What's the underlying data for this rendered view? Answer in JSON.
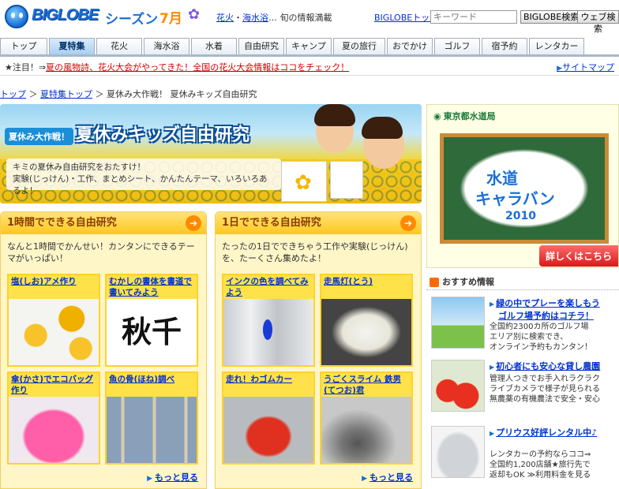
{
  "header": {
    "logo_text": "BIGLOBE",
    "season": "シーズン",
    "month": "7月",
    "tagline_link1": "花火",
    "tagline_sep": "・",
    "tagline_link2": "海水浴",
    "tagline_rest": "… 旬の情報満載",
    "top_link": "BIGLOBEトップ",
    "search_placeholder": "キーワード",
    "search_button": "BIGLOBE検索",
    "web_search_button": "ウェブ検索"
  },
  "nav": {
    "tabs": [
      {
        "label": "トップ"
      },
      {
        "label": "夏特集"
      },
      {
        "label": "花火"
      },
      {
        "label": "海水浴"
      },
      {
        "label": "水着"
      },
      {
        "label": "自由研究"
      },
      {
        "label": "キャンプ"
      },
      {
        "label": "夏の旅行"
      },
      {
        "label": "おでかけ"
      },
      {
        "label": "ゴルフ"
      },
      {
        "label": "宿予約"
      },
      {
        "label": "レンタカー"
      }
    ],
    "active_index": 1
  },
  "notice": {
    "prefix": "★注目！⇒",
    "link": "夏の風物詩、花火大会がやってきた！全国の花火大会情報はココをチェック！",
    "sitemap": "サイトマップ"
  },
  "breadcrumb": {
    "home": "トップ",
    "sep1": "＞",
    "summer": "夏特集トップ",
    "sep2": "＞",
    "current": "夏休み大作戦！ 夏休みキッズ自由研究"
  },
  "hero": {
    "badge": "夏休み大作戦！",
    "title": "夏休みキッズ自由研究",
    "line1": "キミの夏休み自由研究をおたすけ！",
    "line2": "実験(じっけん)・工作、まとめシート、かんたんテーマ、いろいろあるよ！"
  },
  "panels": [
    {
      "title": "1時間でできる自由研究",
      "desc": "なんと1時間でかんせい！カンタンにできるテーマがいっぱい！",
      "items": [
        {
          "label": "塩(しお)アメ作り"
        },
        {
          "label": "むかしの書体を書道で書いてみよう"
        },
        {
          "label": "傘(かさ)でエコバッグ作り"
        },
        {
          "label": "魚の骨(ほね)調べ"
        }
      ],
      "more": "もっと見る"
    },
    {
      "title": "1日でできる自由研究",
      "desc": "たったの1日でできちゃう工作や実験(じっけん)を、たーくさん集めたよ！",
      "items": [
        {
          "label": "インクの色を調べてみよう"
        },
        {
          "label": "走馬灯(とう)"
        },
        {
          "label": "走れ！わゴムカー"
        },
        {
          "label": "うごくスライム 鉄男(てつお)君"
        }
      ],
      "more": "もっと見る"
    }
  ],
  "shodo_text": "秋千",
  "ad": {
    "org": "東京都水道局",
    "line1": "水道",
    "line2": "キャラバン",
    "year": "2010",
    "cta": "詳しくはこちら"
  },
  "recommend": {
    "heading": "おすすめ情報",
    "promos": [
      {
        "title": "緑の中でプレーを楽しもう",
        "title2": "ゴルフ場予約はコチラ！",
        "desc": [
          "全国約2300カ所のゴルフ場",
          "エリア別に検索でき、",
          "オンライン予約もカンタン！"
        ]
      },
      {
        "title": "初心者にも安心な貸し農園",
        "desc": [
          "管理人つきでお手入れラクラク",
          "ライブカメラで様子が見られる",
          "無農薬の有機農法で安全・安心"
        ]
      },
      {
        "title": "プリウス好評レンタル中♪",
        "desc": [
          "レンタカーの予約ならココ⇒",
          "全国約1,200店舗★旅行先で",
          "返却もOK ≫利用料金を見る"
        ]
      }
    ]
  },
  "colors": {
    "brand_blue": "#1a6fd6",
    "accent_orange": "#ff8a00",
    "panel_yellow": "#ffc81e",
    "cta_red": "#d81a1a"
  }
}
